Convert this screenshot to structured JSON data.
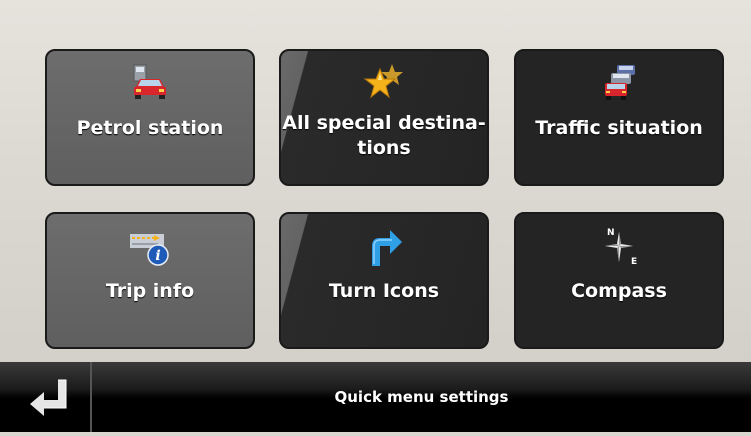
{
  "menu": {
    "tiles": [
      {
        "label": "Petrol station",
        "icon": "petrol-station-icon",
        "style": "grey"
      },
      {
        "label": "All special destina-\ntions",
        "icon": "stars-icon",
        "style": "split"
      },
      {
        "label": "Traffic situation",
        "icon": "traffic-icon",
        "style": "dark"
      },
      {
        "label": "Trip info",
        "icon": "trip-info-icon",
        "style": "grey"
      },
      {
        "label": "Turn Icons",
        "icon": "turn-arrow-icon",
        "style": "split"
      },
      {
        "label": "Compass",
        "icon": "compass-icon",
        "style": "dark"
      }
    ],
    "compass_letters": {
      "north": "N",
      "east": "E"
    }
  },
  "bottom_bar": {
    "title": "Quick menu settings",
    "back_icon": "back-arrow-icon"
  },
  "colors": {
    "tile_grey": "#666666",
    "tile_dark": "#242424",
    "background": "#dcd9d2",
    "bar": "#000000"
  }
}
